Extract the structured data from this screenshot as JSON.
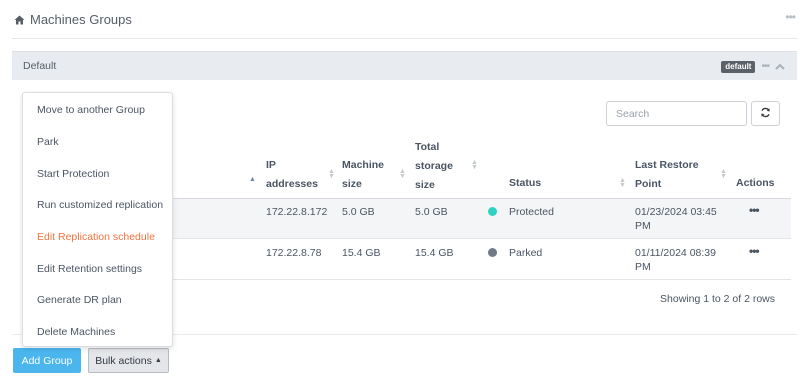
{
  "header": {
    "title": "Machines Groups"
  },
  "group": {
    "name": "Default",
    "badge": "default"
  },
  "toolbar": {
    "search_placeholder": "Search"
  },
  "table": {
    "columns": {
      "ip": [
        "IP",
        "addresses"
      ],
      "size": [
        "Machine",
        "size"
      ],
      "storage": [
        "Total",
        "storage",
        "size"
      ],
      "status": "Status",
      "restore": [
        "Last Restore",
        "Point"
      ],
      "actions": "Actions"
    },
    "rows": [
      {
        "ip": "172.22.8.172",
        "size": "5.0 GB",
        "storage": "5.0 GB",
        "status": "Protected",
        "status_color": "#2fd3c3",
        "restore": [
          "01/23/2024 03:45",
          "PM"
        ],
        "actions": "•••"
      },
      {
        "ip": "172.22.8.78",
        "size": "15.4 GB",
        "storage": "15.4 GB",
        "status": "Parked",
        "status_color": "#707a86",
        "restore": [
          "01/11/2024 08:39",
          "PM"
        ],
        "actions": "•••"
      }
    ],
    "showing": "Showing 1 to 2 of 2 rows"
  },
  "bulk_menu": {
    "items": [
      "Move to another Group",
      "Park",
      "Start Protection",
      "Run customized replication",
      "Edit Replication schedule",
      "Edit Retention settings",
      "Generate DR plan",
      "Delete Machines"
    ],
    "active_color": "#ef7440"
  },
  "footer": {
    "add_group": "Add Group",
    "bulk_actions": "Bulk actions"
  }
}
